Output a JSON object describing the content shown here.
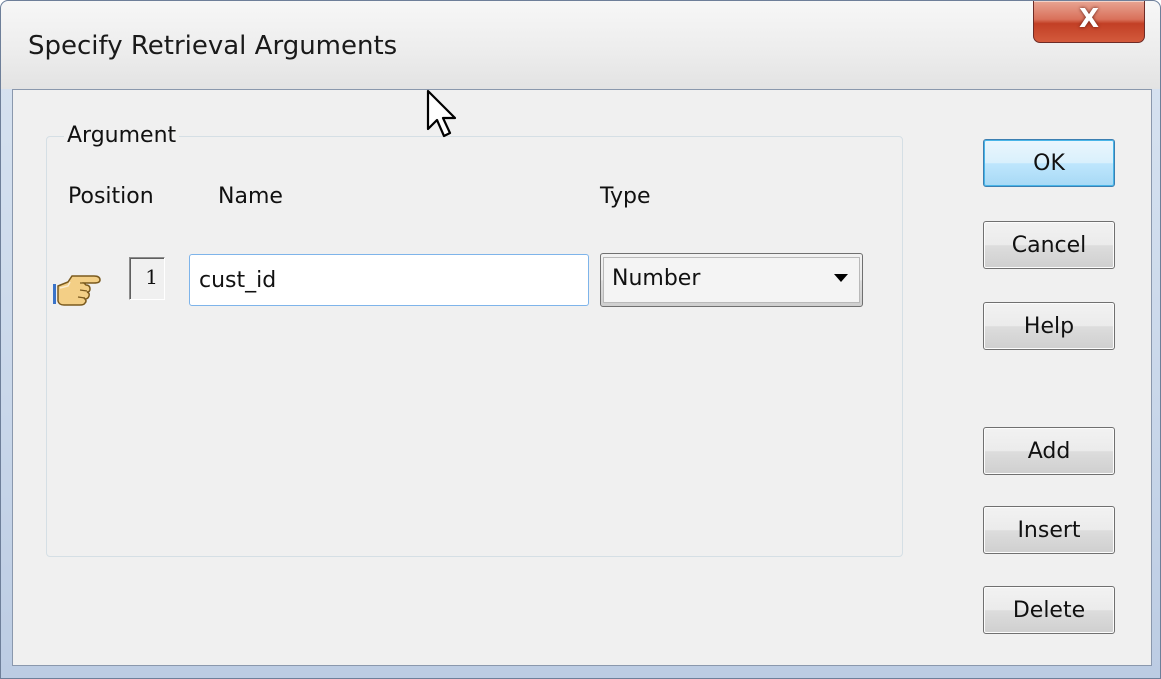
{
  "window": {
    "title": "Specify Retrieval Arguments",
    "close_glyph": "X"
  },
  "argument_group": {
    "legend": "Argument",
    "columns": {
      "position": "Position",
      "name": "Name",
      "type": "Type"
    },
    "rows": [
      {
        "icon": "pointing-hand-icon",
        "position": "1",
        "name": "cust_id",
        "type": "Number"
      }
    ]
  },
  "buttons": {
    "ok": "OK",
    "cancel": "Cancel",
    "help": "Help",
    "add": "Add",
    "insert": "Insert",
    "delete": "Delete"
  },
  "colors": {
    "default_button_border": "#3c7fb1",
    "close_button": "#c23f25",
    "input_focus_border": "#7eb4ea"
  }
}
